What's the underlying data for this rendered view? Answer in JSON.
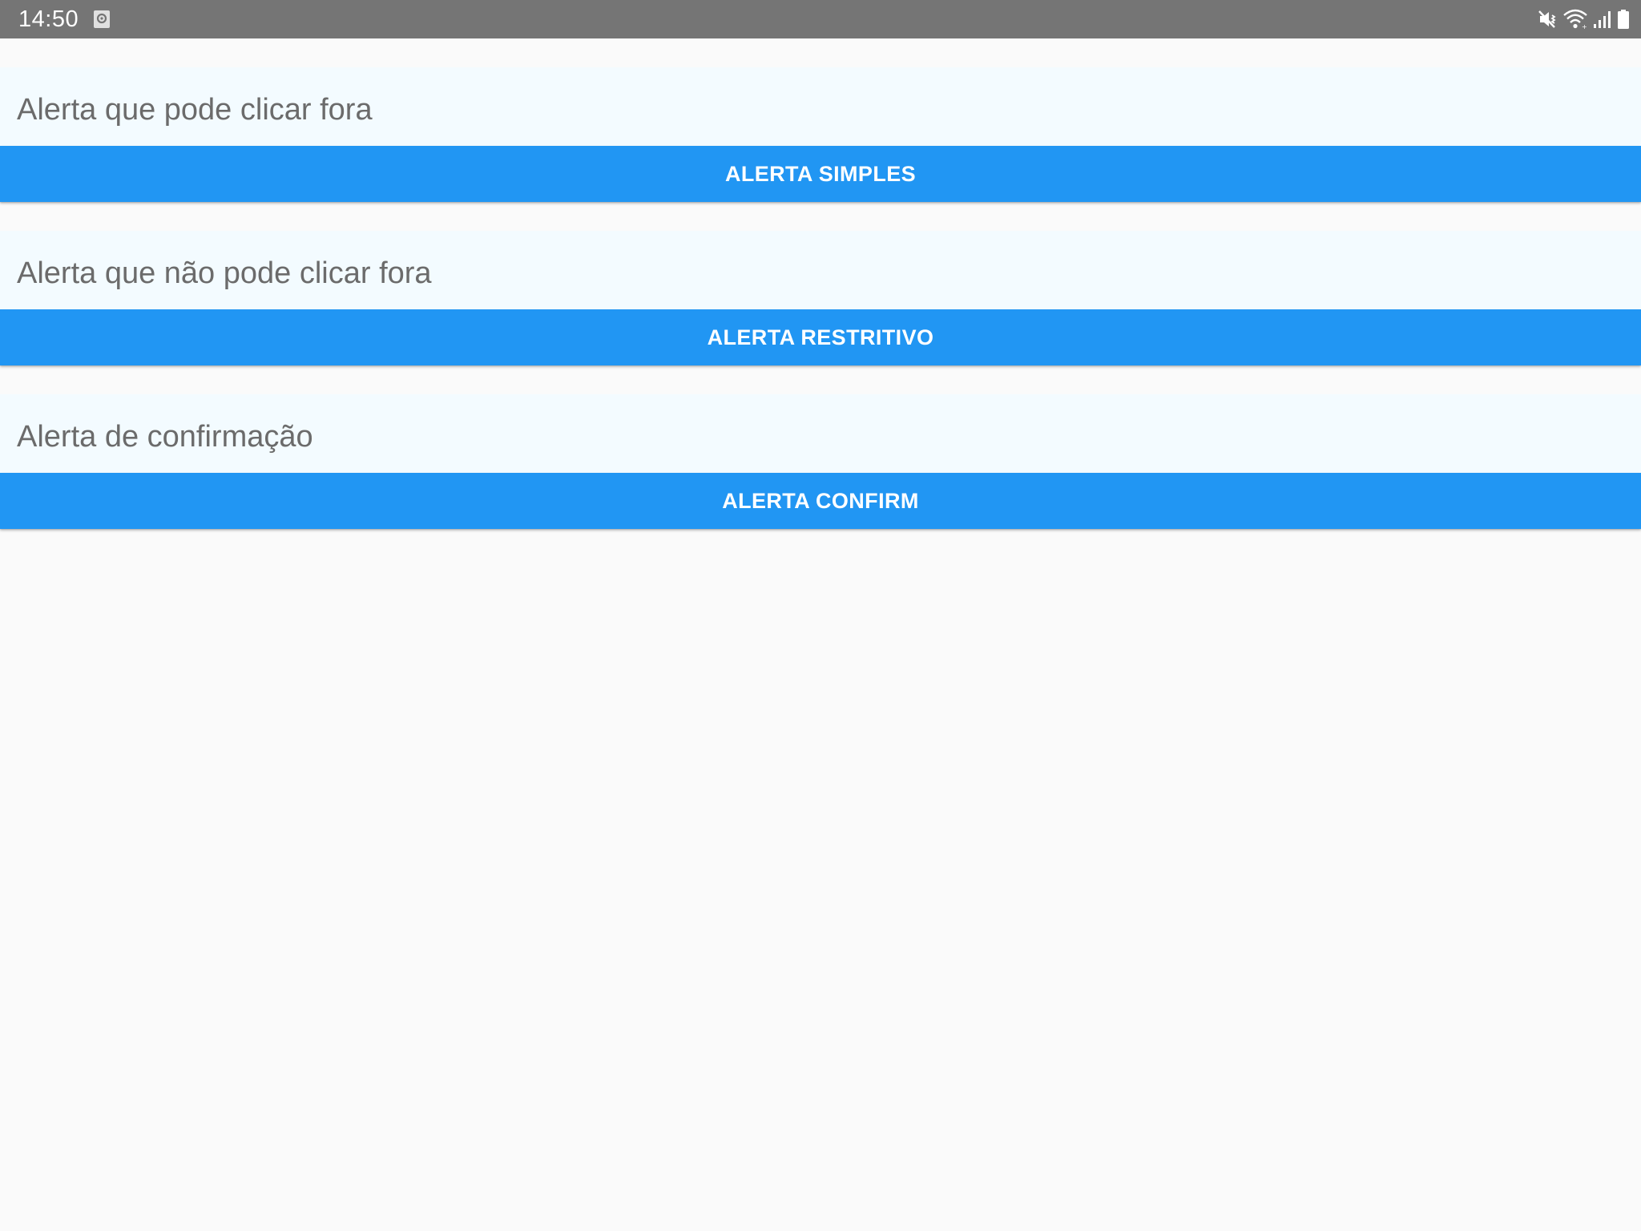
{
  "status_bar": {
    "time": "14:50",
    "icons": [
      "screenshot-notification-icon",
      "vibrate-mute-icon",
      "wifi-icon",
      "cell-signal-icon",
      "battery-icon"
    ],
    "bg_color": "#757575"
  },
  "sections": [
    {
      "label": "Alerta que pode clicar fora",
      "button_label": "ALERTA SIMPLES"
    },
    {
      "label": "Alerta que não pode clicar fora",
      "button_label": "ALERTA RESTRITIVO"
    },
    {
      "label": "Alerta de confirmação",
      "button_label": "ALERTA CONFIRM"
    }
  ],
  "colors": {
    "button": "#2196f3",
    "button_text": "#ffffff",
    "label_text": "#6b6b6b",
    "section_bg": "#f3fbff",
    "page_bg": "#fafafa"
  }
}
